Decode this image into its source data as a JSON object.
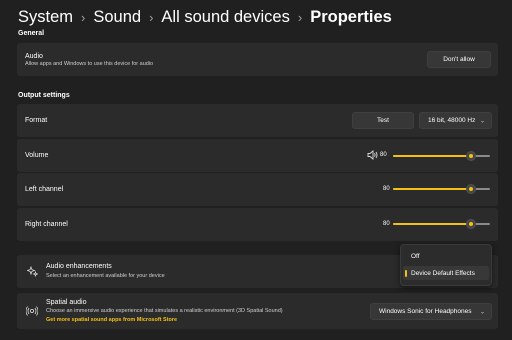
{
  "breadcrumb": {
    "items": [
      "System",
      "Sound",
      "All sound devices"
    ],
    "current": "Properties",
    "separator": "›"
  },
  "general": {
    "heading": "General",
    "audio": {
      "title": "Audio",
      "description": "Allow apps and Windows to use this device for audio",
      "button": "Don't allow"
    }
  },
  "output": {
    "heading": "Output settings",
    "format": {
      "label": "Format",
      "test_button": "Test",
      "value": "16 bit, 48000 Hz"
    },
    "volume": {
      "label": "Volume",
      "value": "80",
      "percent": 80
    },
    "left_channel": {
      "label": "Left channel",
      "value": "80",
      "percent": 80
    },
    "right_channel": {
      "label": "Right channel",
      "value": "80",
      "percent": 80
    }
  },
  "enhancements": {
    "title": "Audio enhancements",
    "description": "Select an enhancement available for your device",
    "menu": {
      "options": [
        "Off",
        "Device Default Effects"
      ],
      "selected": "Device Default Effects"
    }
  },
  "spatial": {
    "title": "Spatial audio",
    "description": "Choose an immersive audio experience that simulates a realistic environment (3D Spatial Sound)",
    "link": "Get more spatial sound apps from Microsoft Store",
    "value": "Windows Sonic for Headphones"
  },
  "colors": {
    "accent": "#f3c013",
    "background": "#202020",
    "card": "#2b2b2b"
  },
  "icons": [
    "speaker-icon",
    "chevron-down-icon",
    "sparkle-icon",
    "spatial-audio-icon"
  ]
}
